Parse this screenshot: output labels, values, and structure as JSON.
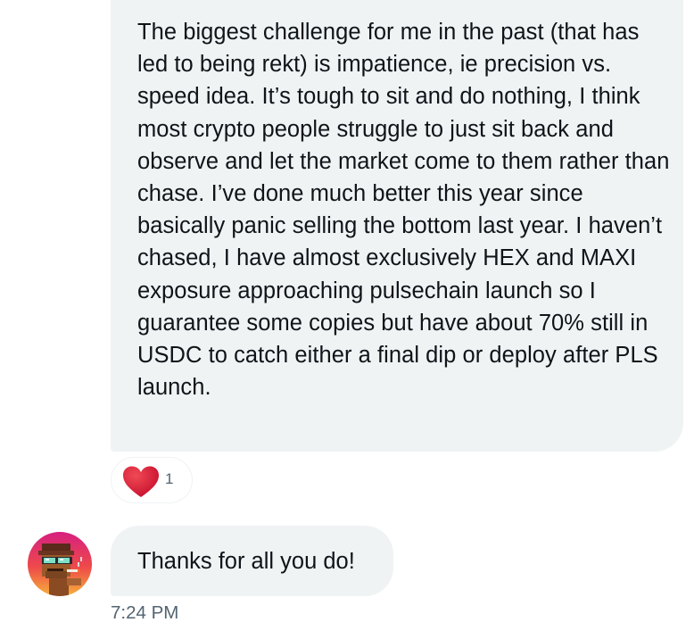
{
  "messages": [
    {
      "text": "The biggest challenge for me in the past (that has led to being rekt) is impatience, ie precision vs. speed idea. It’s tough to sit and do nothing, I think most crypto people struggle to just sit back and observe and let the market come to them rather than chase. I’ve done much better this year since basically panic selling the bottom last year. I haven’t chased, I have almost exclusively HEX and MAXI exposure approaching pulsechain launch so I guarantee some copies but have about 70% still in USDC to catch either a final dip or deploy after PLS launch.",
      "reaction": {
        "icon": "heart-icon",
        "count": "1",
        "color": "#f91880"
      }
    },
    {
      "text": "Thanks for all you do!",
      "timestamp": "7:24 PM"
    }
  ],
  "avatar": {
    "icon": "pixel-art-avatar-icon"
  },
  "colors": {
    "bubble": "#eff3f4",
    "text": "#0f1419",
    "secondary_text": "#536471",
    "heart": "#f91880"
  }
}
